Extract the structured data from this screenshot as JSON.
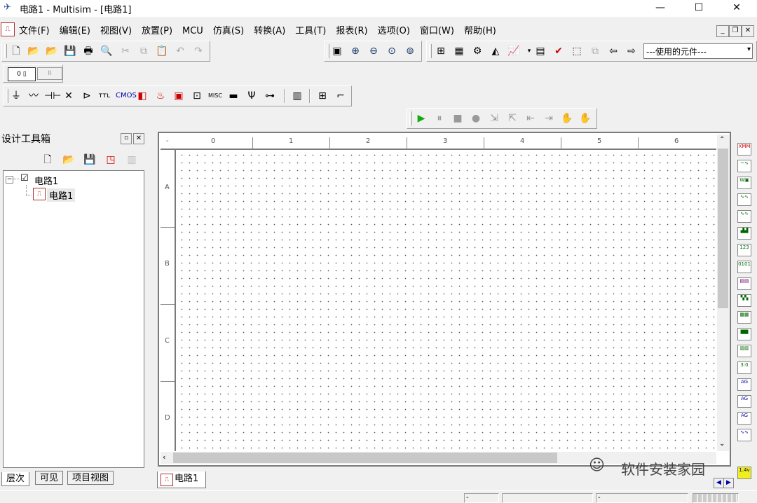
{
  "window": {
    "title": "电路1 - Multisim - [电路1]",
    "minimize": "—",
    "maximize": "☐",
    "close": "✕"
  },
  "menu": [
    "文件(F)",
    "编辑(E)",
    "视图(V)",
    "放置(P)",
    "MCU",
    "仿真(S)",
    "转换(A)",
    "工具(T)",
    "报表(R)",
    "选项(O)",
    "窗口(W)",
    "帮助(H)"
  ],
  "toolbar": {
    "component_select_value": "---使用的元件---"
  },
  "sidebar": {
    "title": "设计工具箱",
    "tree_root": "电路1",
    "tree_child": "电路1",
    "tabs": [
      "层次",
      "可见",
      "项目视图"
    ]
  },
  "ruler": {
    "columns": [
      "0",
      "1",
      "2",
      "3",
      "4",
      "5",
      "6"
    ],
    "rows": [
      "A",
      "B",
      "C",
      "D"
    ]
  },
  "canvas_tab": "电路1",
  "watermark": "软件安装家园",
  "instrument_last_label": "1.4v"
}
